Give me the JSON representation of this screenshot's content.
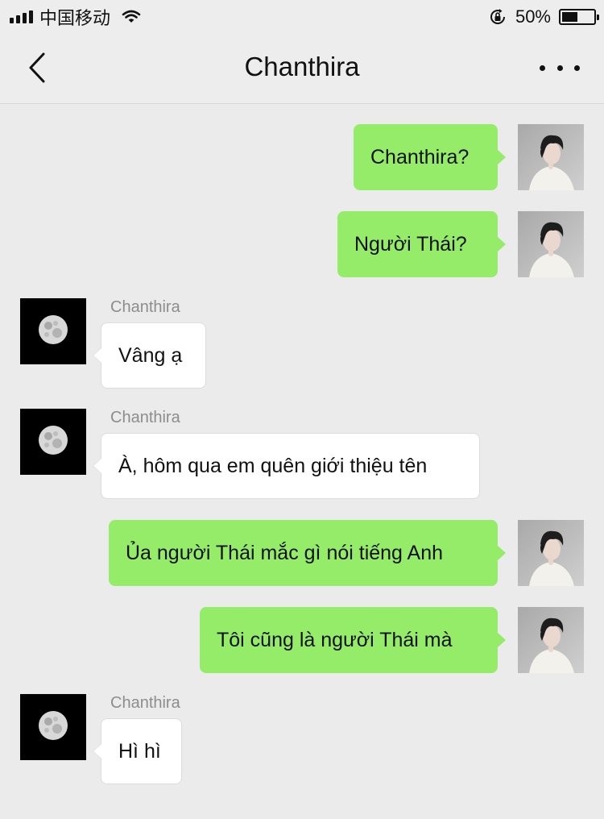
{
  "status_bar": {
    "carrier": "中国移动",
    "battery_percent": "50%",
    "battery_level": 0.5,
    "signal_icon": "signal-bars-icon",
    "wifi_icon": "wifi-icon",
    "lock_icon": "rotation-lock-icon"
  },
  "nav": {
    "title": "Chanthira",
    "back_icon": "chevron-left-icon",
    "more_icon": "more-dots-icon"
  },
  "colors": {
    "background": "#ebebeb",
    "bubble_me": "#95ec69",
    "bubble_them": "#ffffff",
    "sender_name": "#8d8d8d"
  },
  "messages": [
    {
      "from": "me",
      "text": "Chanthira?"
    },
    {
      "from": "me",
      "text": "Người Thái?"
    },
    {
      "from": "them",
      "name": "Chanthira",
      "text": "Vâng ạ"
    },
    {
      "from": "them",
      "name": "Chanthira",
      "text": "À, hôm qua em quên giới thiệu tên"
    },
    {
      "from": "me",
      "text": "Ủa người Thái mắc gì nói tiếng Anh"
    },
    {
      "from": "me",
      "text": "Tôi cũng là người Thái mà"
    },
    {
      "from": "them",
      "name": "Chanthira",
      "text": "Hì hì"
    }
  ]
}
